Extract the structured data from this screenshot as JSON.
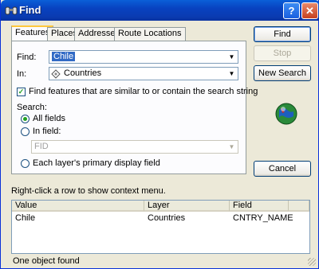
{
  "window": {
    "title": "Find",
    "help_glyph": "?",
    "close_glyph": "✕"
  },
  "tabs": [
    {
      "label": "Features",
      "active": true
    },
    {
      "label": "Places"
    },
    {
      "label": "Addresses"
    },
    {
      "label": "Route Locations"
    }
  ],
  "form": {
    "find_label": "Find:",
    "find_value": "Chile",
    "in_label": "In:",
    "in_value": "Countries",
    "similar_checkbox_label": "Find features that are similar to or contain the search string",
    "similar_checked": true,
    "search_label": "Search:",
    "radio_all_fields": "All fields",
    "radio_in_field": "In field:",
    "field_value": "FID",
    "radio_primary_field": "Each layer's primary display field"
  },
  "buttons": {
    "find": "Find",
    "stop": "Stop",
    "new_search": "New Search",
    "cancel": "Cancel"
  },
  "results": {
    "hint": "Right-click a row to show context menu.",
    "columns": [
      "Value",
      "Layer",
      "Field"
    ],
    "rows": [
      [
        "Chile",
        "Countries",
        "CNTRY_NAME"
      ]
    ]
  },
  "status": "One object found",
  "icons": {
    "title": "binoculars-icon",
    "layer": "layer-diamond-icon",
    "animation": "globe-icon"
  }
}
